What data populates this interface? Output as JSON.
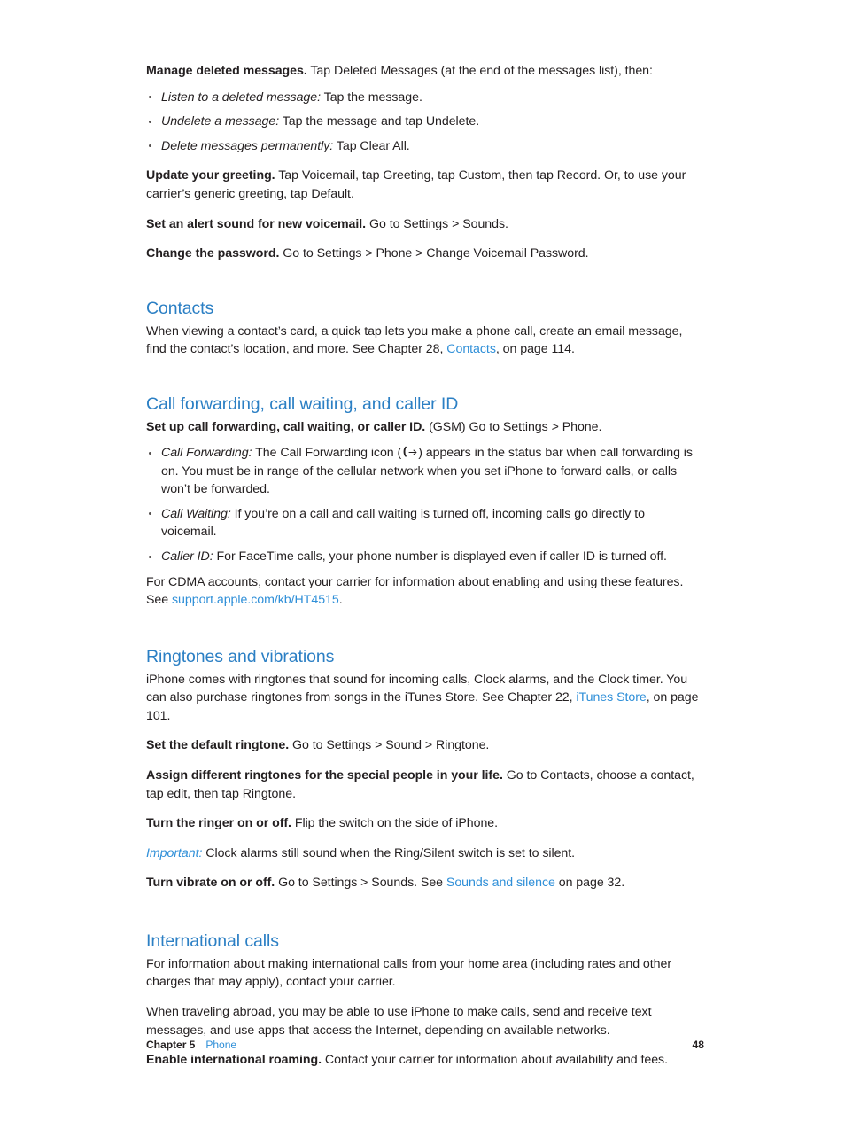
{
  "document": {
    "voicemail_tasks": {
      "manage_deleted": {
        "lead": "Manage deleted messages.",
        "text": " Tap Deleted Messages (at the end of the messages list), then:"
      },
      "bullets": [
        {
          "term": "Listen to a deleted message:",
          "desc": " Tap the message."
        },
        {
          "term": "Undelete a message:",
          "desc": " Tap the message and tap Undelete."
        },
        {
          "term": "Delete messages permanently:",
          "desc": " Tap Clear All."
        }
      ],
      "update_greeting": {
        "lead": "Update your greeting.",
        "text": " Tap Voicemail, tap Greeting, tap Custom, then tap Record. Or, to use your carrier’s generic greeting, tap Default."
      },
      "alert_sound": {
        "lead": "Set an alert sound for new voicemail.",
        "text": " Go to Settings > Sounds."
      },
      "change_password": {
        "lead": "Change the password.",
        "text": " Go to Settings > Phone > Change Voicemail Password."
      }
    },
    "contacts": {
      "heading": "Contacts",
      "para_part1": "When viewing a contact’s card, a quick tap lets you make a phone call, create an email message, find the contact’s location, and more. See Chapter 28, ",
      "link": "Contacts",
      "para_part2": ", on page 114."
    },
    "call_forwarding": {
      "heading": "Call forwarding, call waiting, and caller ID",
      "setup": {
        "lead": "Set up call forwarding, call waiting, or caller ID.",
        "text": " (GSM) Go to Settings > Phone."
      },
      "bullets": [
        {
          "term": "Call Forwarding:",
          "desc_before": " The Call Forwarding icon (",
          "icon": "call-forwarding-icon",
          "desc_after": ") appears in the status bar when call forwarding is on. You must be in range of the cellular network when you set iPhone to forward calls, or calls won’t be forwarded."
        },
        {
          "term": "Call Waiting:",
          "desc": " If you’re on a call and call waiting is turned off, incoming calls go directly to voicemail."
        },
        {
          "term": "Caller ID:",
          "desc": " For FaceTime calls, your phone number is displayed even if caller ID is turned off."
        }
      ],
      "cdma_part1": "For CDMA accounts, contact your carrier for information about enabling and using these features. See ",
      "cdma_link": "support.apple.com/kb/HT4515",
      "cdma_part2": "."
    },
    "ringtones": {
      "heading": "Ringtones and vibrations",
      "intro_part1": "iPhone comes with ringtones that sound for incoming calls, Clock alarms, and the Clock timer. You can also purchase ringtones from songs in the iTunes Store. See Chapter 22, ",
      "intro_link": "iTunes Store",
      "intro_part2": ", on page 101.",
      "default_ringtone": {
        "lead": "Set the default ringtone.",
        "text": " Go to Settings > Sound > Ringtone."
      },
      "assign_ringtones": {
        "lead": "Assign different ringtones for the special people in your life.",
        "text": " Go to Contacts, choose a contact, tap edit, then tap Ringtone."
      },
      "ringer_switch": {
        "lead": "Turn the ringer on or off.",
        "text": " Flip the switch on the side of iPhone."
      },
      "important": {
        "lead": "Important:",
        "text": " Clock alarms still sound when the Ring/Silent switch is set to silent."
      },
      "vibrate": {
        "lead": "Turn vibrate on or off.",
        "text_part1": " Go to Settings > Sounds. See ",
        "link": "Sounds and silence",
        "text_part2": " on page 32."
      }
    },
    "international": {
      "heading": "International calls",
      "para1": "For information about making international calls from your home area (including rates and other charges that may apply), contact your carrier.",
      "para2": "When traveling abroad, you may be able to use iPhone to make calls, send and receive text messages, and use apps that access the Internet, depending on available networks.",
      "roaming": {
        "lead": "Enable international roaming.",
        "text": " Contact your carrier for information about availability and fees."
      }
    },
    "footer": {
      "chapter": "Chapter  5",
      "chapter_name": "Phone",
      "page_number": "48"
    },
    "colors": {
      "heading_blue": "#2b7fc4",
      "link_blue": "#2f8fd8",
      "body_text": "#231f20",
      "background": "#ffffff"
    }
  }
}
